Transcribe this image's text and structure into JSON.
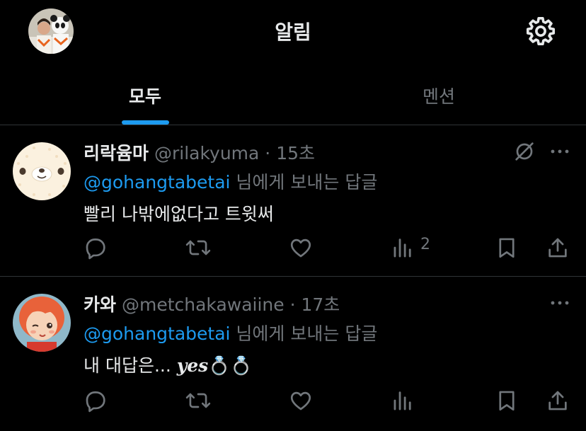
{
  "header": {
    "title": "알림",
    "avatar_icon": "profile-avatar-panda",
    "settings_icon": "gear-icon"
  },
  "tabs": [
    {
      "label": "모두",
      "active": true
    },
    {
      "label": "멘션",
      "active": false
    }
  ],
  "colors": {
    "background": "#000000",
    "accent": "#1d9bf0",
    "primary_text": "#e7e9ea",
    "secondary_text": "#71767b",
    "divider": "#2f3336"
  },
  "tweets": [
    {
      "display_name": "리락윰마",
      "handle": "@rilakyuma",
      "separator": " · ",
      "time": "15초",
      "reply_to_user": "@gohangtabetai",
      "reply_to_suffix": " 님에게 보내는 답글",
      "body": "빨리 나밖에없다고 트윗써",
      "views_count": "2",
      "avatar_icon": "rilakkuma-avatar",
      "has_mute_icon": true
    },
    {
      "display_name": "카와",
      "handle": "@metchakawaiine",
      "separator": " · ",
      "time": "17초",
      "reply_to_user": "@gohangtabetai",
      "reply_to_suffix": " 님에게 보내는 답글",
      "body_prefix": "내 대답은... ",
      "body_emph": "yes",
      "body_emoji": "💍💍",
      "views_count": "",
      "avatar_icon": "anime-girl-avatar",
      "has_mute_icon": false
    }
  ]
}
